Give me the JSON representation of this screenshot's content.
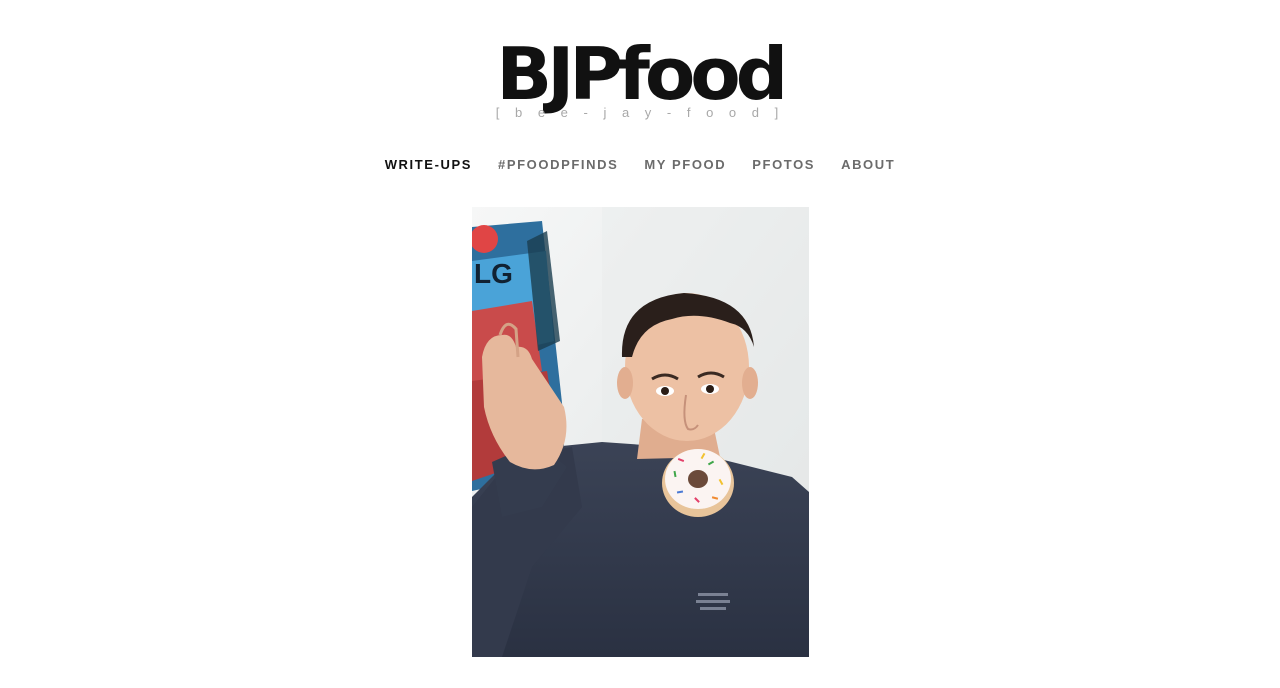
{
  "site": {
    "title": "BJPfood",
    "pronunciation": "[ b e e - j a y - f o o d ]"
  },
  "nav": {
    "items": [
      {
        "label": "WRITE-UPS",
        "active": true
      },
      {
        "label": "#PFOODPFINDS",
        "active": false
      },
      {
        "label": "MY PFOOD",
        "active": false
      },
      {
        "label": "PFOTOS",
        "active": false
      },
      {
        "label": "ABOUT",
        "active": false
      }
    ]
  },
  "hero": {
    "subject": "man holding a snack bag with a sprinkled donut in his mouth"
  }
}
